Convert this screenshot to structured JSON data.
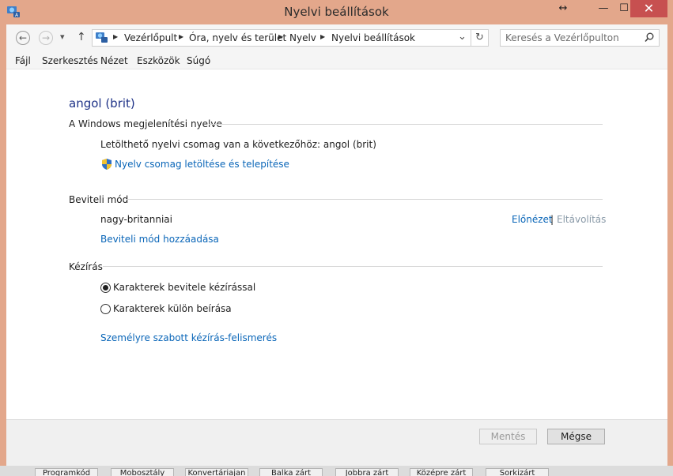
{
  "window": {
    "title": "Nyelvi beállítások",
    "resize_glyph": "↔",
    "minimize_glyph": "—",
    "maximize_glyph": "☐",
    "close_glyph": "✕"
  },
  "nav": {
    "back_glyph": "←",
    "forward_glyph": "→",
    "dropdown_glyph": "▾",
    "up_glyph": "↑",
    "breadcrumb": [
      "Vezérlőpult",
      "Óra, nyelv és terület",
      "Nyelv",
      "Nyelvi beállítások"
    ],
    "breadcrumb_sep": "▶",
    "address_dropdown_glyph": "⌄",
    "refresh_glyph": "↻",
    "search_placeholder": "Keresés a Vezérlőpulton",
    "search_glyph": "⚲"
  },
  "menu": [
    "Fájl",
    "Szerkesztés",
    "Nézet",
    "Eszközök",
    "Súgó"
  ],
  "main": {
    "heading": "angol (brit)",
    "display_section": {
      "title": "A Windows megjelenítési nyelve",
      "info": "Letölthető nyelvi csomag van a következőhöz: angol (brit)",
      "download_link": "Nyelv csomag letöltése és telepítése"
    },
    "input_section": {
      "title": "Beviteli mód",
      "method_name": "nagy-britanniai",
      "preview_link": "Előnézet",
      "separator": "|",
      "remove_link": "Eltávolítás",
      "add_link": "Beviteli mód hozzáadása"
    },
    "handwriting_section": {
      "title": "Kézírás",
      "options": [
        {
          "label": "Karakterek bevitele kézírással",
          "selected": true
        },
        {
          "label": "Karakterek külön beírása",
          "selected": false
        }
      ],
      "personalize_link": "Személyre szabott kézírás-felismerés"
    }
  },
  "footer": {
    "save_label": "Mentés",
    "cancel_label": "Mégse"
  },
  "taskbar": [
    "Programkód",
    "Mobosztály",
    "Konvertáriajan",
    "Balka zárt",
    "Jobbra zárt",
    "Középre zárt",
    "Sorkizárt"
  ],
  "colors": {
    "title_bar": "#e3a78b",
    "close_button": "#c75050",
    "link": "#0a66b8",
    "heading": "#1e3287"
  }
}
